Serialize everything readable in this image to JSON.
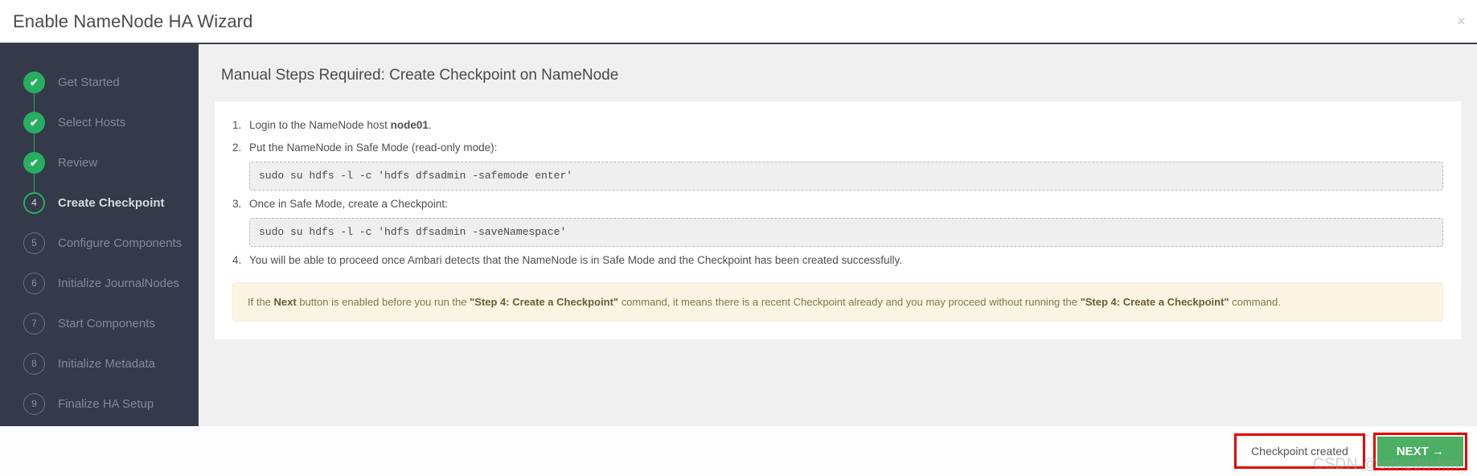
{
  "window": {
    "title": "Enable NameNode HA Wizard",
    "close_icon": "×"
  },
  "sidebar": {
    "steps": [
      {
        "num": "1",
        "label": "Get Started",
        "state": "done",
        "icon": "check-icon"
      },
      {
        "num": "2",
        "label": "Select Hosts",
        "state": "done",
        "icon": "check-icon"
      },
      {
        "num": "3",
        "label": "Review",
        "state": "done",
        "icon": "check-icon"
      },
      {
        "num": "4",
        "label": "Create Checkpoint",
        "state": "current",
        "icon": ""
      },
      {
        "num": "5",
        "label": "Configure Components",
        "state": "todo",
        "icon": ""
      },
      {
        "num": "6",
        "label": "Initialize JournalNodes",
        "state": "todo",
        "icon": ""
      },
      {
        "num": "7",
        "label": "Start Components",
        "state": "todo",
        "icon": ""
      },
      {
        "num": "8",
        "label": "Initialize Metadata",
        "state": "todo",
        "icon": ""
      },
      {
        "num": "9",
        "label": "Finalize HA Setup",
        "state": "todo",
        "icon": ""
      }
    ],
    "check_glyph": "✔"
  },
  "content": {
    "title": "Manual Steps Required: Create Checkpoint on NameNode",
    "step1": {
      "pre": "Login to the NameNode host ",
      "host": "node01",
      "post": "."
    },
    "step2": {
      "text": "Put the NameNode in Safe Mode (read-only mode):",
      "code": "sudo su hdfs -l -c 'hdfs dfsadmin -safemode enter'"
    },
    "step3": {
      "text": "Once in Safe Mode, create a Checkpoint:",
      "code": "sudo su hdfs -l -c 'hdfs dfsadmin -saveNamespace'"
    },
    "step4": {
      "text": "You will be able to proceed once Ambari detects that the NameNode is in Safe Mode and the Checkpoint has been created successfully."
    },
    "note": {
      "part1": "If the ",
      "bold1": "Next",
      "part2": " button is enabled before you run the ",
      "bold2": "\"Step 4: Create a Checkpoint\"",
      "part3": " command, it means there is a recent Checkpoint already and you may proceed without running the ",
      "bold3": "\"Step 4: Create a Checkpoint\"",
      "part4": " command."
    }
  },
  "footer": {
    "secondary_label": "Checkpoint created",
    "primary_label": "NEXT →",
    "watermark": "CSDN @sdhzdtwhm"
  },
  "colors": {
    "sidebar_bg": "#343a4a",
    "accent_green": "#27ae60",
    "primary_button": "#4caf64",
    "annotation_red": "#e60000",
    "note_bg": "#fcf5e3"
  }
}
